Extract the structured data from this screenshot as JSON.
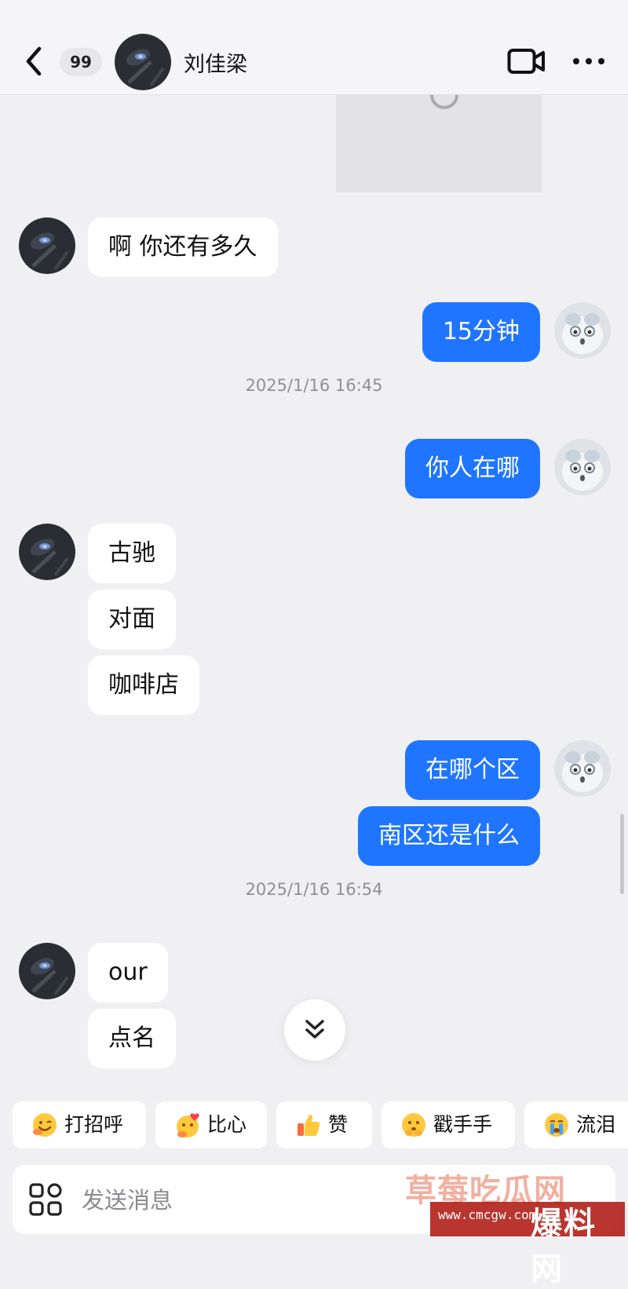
{
  "header": {
    "back_icon": "chevron-left-icon",
    "unread_badge": "99",
    "contact_name": "刘佳梁",
    "video_icon": "video-call-icon",
    "more_icon": "more-dots-icon"
  },
  "messages": [
    {
      "type": "image",
      "from": "me"
    },
    {
      "type": "text",
      "from": "them",
      "text": "啊 你还有多久"
    },
    {
      "type": "text",
      "from": "me",
      "text": "15分钟"
    },
    {
      "type": "timestamp",
      "text": "2025/1/16 16:45"
    },
    {
      "type": "text",
      "from": "me",
      "text": "你人在哪"
    },
    {
      "type": "text",
      "from": "them",
      "text": "古驰"
    },
    {
      "type": "text",
      "from": "them",
      "text": "对面"
    },
    {
      "type": "text",
      "from": "them",
      "text": "咖啡店"
    },
    {
      "type": "text",
      "from": "me",
      "text": "在哪个区"
    },
    {
      "type": "text",
      "from": "me",
      "text": "南区还是什么"
    },
    {
      "type": "timestamp",
      "text": "2025/1/16 16:54"
    },
    {
      "type": "text",
      "from": "them",
      "text": "our"
    },
    {
      "type": "text",
      "from": "them",
      "text": "点名"
    }
  ],
  "scroll_to_bottom_icon": "double-chevron-down-icon",
  "quick_reactions": [
    {
      "emoji": "greeting-emoji-icon",
      "label": "打招呼"
    },
    {
      "emoji": "heart-hands-emoji-icon",
      "label": "比心"
    },
    {
      "emoji": "thumbs-up-emoji-icon",
      "label": "赞"
    },
    {
      "emoji": "poke-emoji-icon",
      "label": "戳手手"
    },
    {
      "emoji": "crying-emoji-icon",
      "label": "流泪"
    }
  ],
  "input": {
    "apps_icon": "apps-grid-icon",
    "placeholder": "发送消息"
  },
  "watermark": {
    "line1": "草莓吃瓜网",
    "line2": "www.cmcgw.com",
    "line3": "爆料网"
  },
  "colors": {
    "outgoing_bubble": "#1f75ff",
    "incoming_bubble": "#ffffff",
    "background": "#f0f0f2"
  }
}
